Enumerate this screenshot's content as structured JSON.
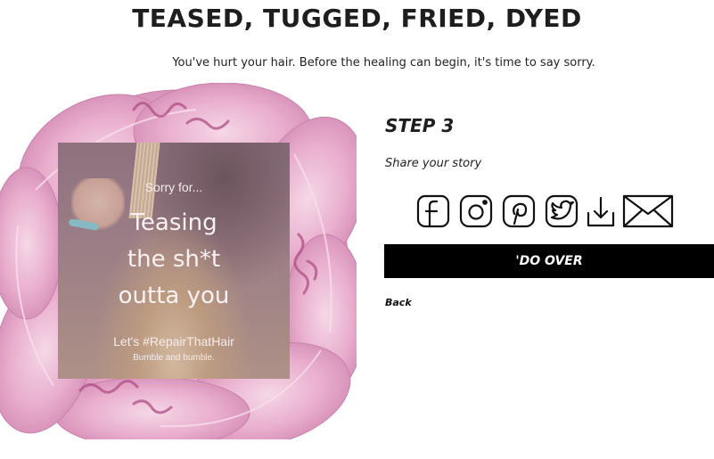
{
  "header": {
    "title": "TEASED, TUGGED, FRIED, DYED",
    "subtitle": "You've hurt your hair. Before the healing can begin, it's time to say sorry."
  },
  "card": {
    "sorry_for": "Sorry for...",
    "phrase_lines": [
      "Teasing",
      "the sh*t",
      "outta you"
    ],
    "hashtag": "Let's #RepairThatHair",
    "brand": "Bumble and bumble."
  },
  "step": {
    "title": "STEP 3",
    "description": "Share your story"
  },
  "share_icons": [
    "facebook-icon",
    "instagram-icon",
    "pinterest-icon",
    "twitter-icon",
    "download-icon",
    "email-icon"
  ],
  "actions": {
    "redo_label": "'DO OVER",
    "back_label": "Back"
  },
  "colors": {
    "petal": "#e7a9c9",
    "petal_dark": "#b9578f",
    "button_bg": "#000000",
    "button_text": "#ffffff"
  }
}
